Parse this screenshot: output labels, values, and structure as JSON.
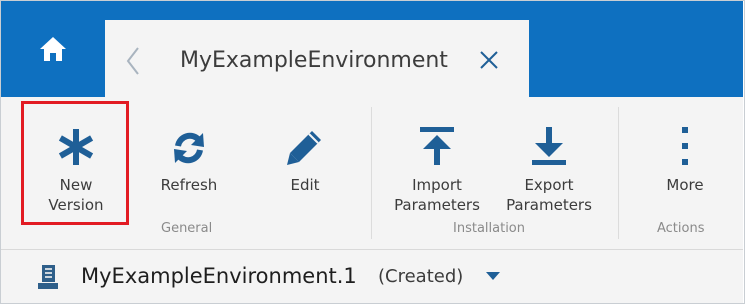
{
  "colors": {
    "header_bg": "#0e70c0",
    "ribbon_bg": "#f4f4f4",
    "icon_blue": "#1f5f97",
    "highlight_red": "#e21b23"
  },
  "header": {
    "home_icon": "home-icon",
    "tab": {
      "title": "MyExampleEnvironment",
      "back_icon": "chevron-left-icon",
      "close_icon": "close-icon"
    }
  },
  "ribbon": {
    "groups": {
      "general": "General",
      "installation": "Installation",
      "actions": "Actions"
    },
    "buttons": {
      "new_version": {
        "label": "New\nVersion",
        "icon": "asterisk-icon"
      },
      "refresh": {
        "label": "Refresh",
        "icon": "refresh-icon"
      },
      "edit": {
        "label": "Edit",
        "icon": "pencil-icon"
      },
      "import_parameters": {
        "label": "Import\nParameters",
        "icon": "import-arrow-icon"
      },
      "export_parameters": {
        "label": "Export\nParameters",
        "icon": "export-arrow-icon"
      },
      "more": {
        "label": "More",
        "icon": "vertical-ellipsis-icon"
      }
    }
  },
  "object": {
    "icon": "environment-icon",
    "name": "MyExampleEnvironment.1",
    "status": "(Created)",
    "caret_icon": "caret-down-icon"
  }
}
